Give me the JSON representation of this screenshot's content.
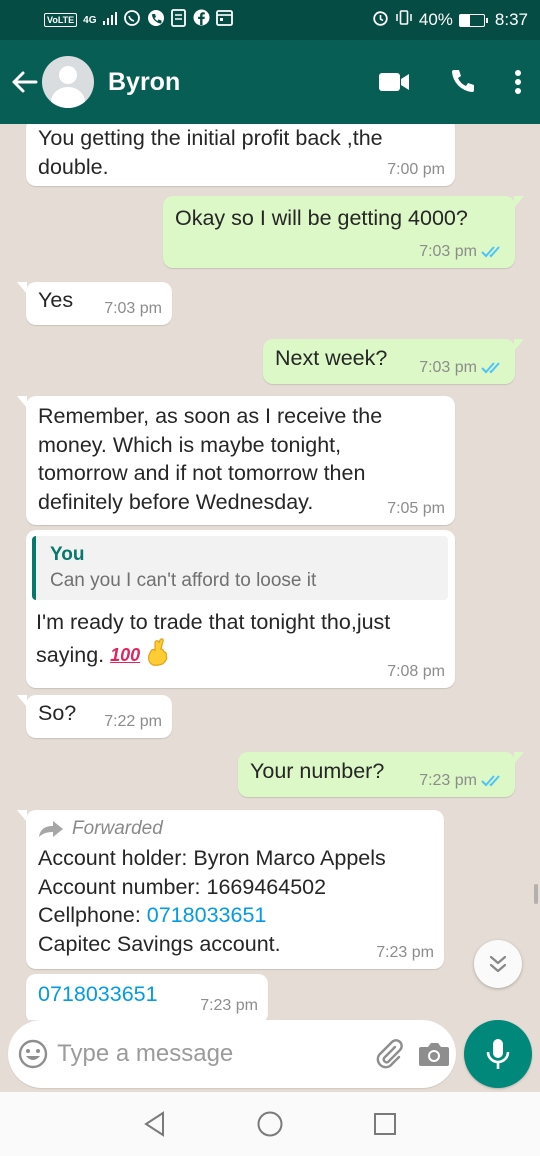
{
  "status_bar": {
    "network_badge": "VoLTE",
    "signal": "4G",
    "battery": "40%",
    "battery_level": 0.4,
    "time": "8:37"
  },
  "header": {
    "contact_name": "Byron",
    "accent_color": "#075e54"
  },
  "messages": [
    {
      "id": "m1",
      "direction": "in",
      "lines": [
        "You getting the initial profit back ,the",
        "double."
      ],
      "time": "7:00 pm"
    },
    {
      "id": "m2",
      "direction": "out",
      "lines": [
        "Okay so I will be getting 4000?"
      ],
      "time": "7:03 pm",
      "read": true
    },
    {
      "id": "m3",
      "direction": "in",
      "lines": [
        "Yes"
      ],
      "time": "7:03 pm"
    },
    {
      "id": "m4",
      "direction": "out",
      "lines": [
        "Next week?"
      ],
      "time": "7:03 pm",
      "read": true
    },
    {
      "id": "m5",
      "direction": "in",
      "lines": [
        "Remember, as soon as I receive the",
        "money. Which is maybe tonight,",
        "tomorrow and if not tomorrow then",
        "definitely before Wednesday."
      ],
      "time": "7:05 pm"
    },
    {
      "id": "m6",
      "direction": "in",
      "quote_author": "You",
      "quote_text": "Can you I can't afford to loose it",
      "lines": [
        "I'm ready to trade that tonight tho,just",
        "saying."
      ],
      "emoji": [
        "100",
        "crossed-fingers"
      ],
      "time": "7:08 pm"
    },
    {
      "id": "m7",
      "direction": "in",
      "lines": [
        "So?"
      ],
      "time": "7:22 pm"
    },
    {
      "id": "m8",
      "direction": "out",
      "lines": [
        "Your number?"
      ],
      "time": "7:23 pm",
      "read": true
    },
    {
      "id": "m9",
      "direction": "in",
      "forwarded_label": "Forwarded",
      "lines": [
        "Account holder: Byron Marco Appels",
        "Account number: 1669464502"
      ],
      "phone_prefix": "Cellphone: ",
      "phone": "0718033651",
      "last_line": "Capitec Savings account.",
      "time": "7:23 pm"
    },
    {
      "id": "m10",
      "direction": "in",
      "phone": "0718033651",
      "time": "7:23 pm"
    }
  ],
  "input": {
    "placeholder": "Type a message"
  },
  "icons": [
    "back-arrow-icon",
    "video-call-icon",
    "voice-call-icon",
    "more-options-icon",
    "emoji-icon",
    "attach-icon",
    "camera-icon",
    "mic-icon",
    "double-check-icon",
    "forward-icon",
    "scroll-down-icon",
    "nav-back-icon",
    "nav-home-icon",
    "nav-recents-icon"
  ],
  "colors": {
    "outgoing_bubble": "#dcf8c6",
    "incoming_bubble": "#ffffff",
    "read_ticks": "#4fc3f7",
    "link": "#039be5",
    "mic_button": "#00897b"
  }
}
